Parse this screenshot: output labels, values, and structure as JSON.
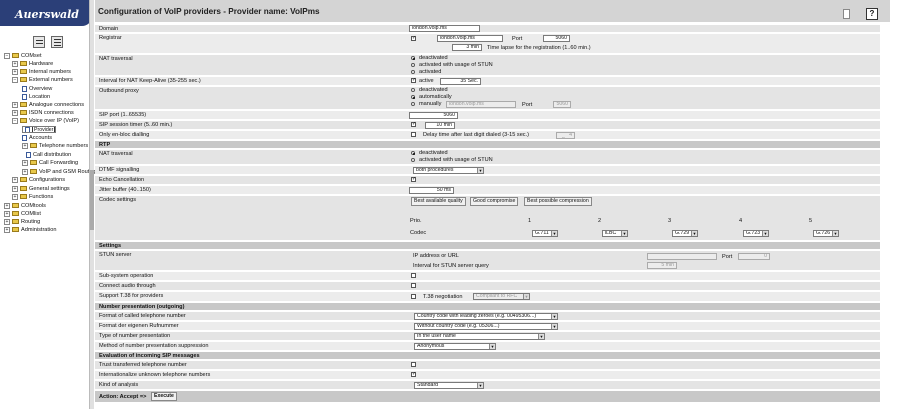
{
  "logo_text": "Auerswald",
  "title": "Configuration of VoIP providers - Provider name: VoIPms",
  "help_label": "?",
  "tree": [
    {
      "label": "COMset",
      "kind": "folder"
    },
    {
      "label": "Hardware",
      "kind": "folder"
    },
    {
      "label": "Internal numbers",
      "kind": "folder"
    },
    {
      "label": "External numbers",
      "kind": "folder"
    },
    {
      "label": "Overview",
      "kind": "page"
    },
    {
      "label": "Location",
      "kind": "page"
    },
    {
      "label": "Analogue connections",
      "kind": "folder"
    },
    {
      "label": "ISDN connections",
      "kind": "folder"
    },
    {
      "label": "Voice over IP (VoIP)",
      "kind": "folder"
    },
    {
      "label": "Provider",
      "kind": "page"
    },
    {
      "label": "Accounts",
      "kind": "page"
    },
    {
      "label": "Telephone numbers",
      "kind": "folder"
    },
    {
      "label": "Call distribution",
      "kind": "page"
    },
    {
      "label": "Call Forwarding",
      "kind": "folder"
    },
    {
      "label": "VoIP and GSM Routing",
      "kind": "folder"
    },
    {
      "label": "Configurations",
      "kind": "folder"
    },
    {
      "label": "General settings",
      "kind": "folder"
    },
    {
      "label": "Functions",
      "kind": "folder"
    },
    {
      "label": "COMtools",
      "kind": "folder"
    },
    {
      "label": "COMlist",
      "kind": "folder"
    },
    {
      "label": "Routing",
      "kind": "folder"
    },
    {
      "label": "Administration",
      "kind": "folder"
    }
  ],
  "form": {
    "domain": {
      "label": "Domain",
      "value": "london.voip.ms"
    },
    "registrar": {
      "label": "Registrar",
      "host": "london.voip.ms",
      "port_label": "Port",
      "port": "5060",
      "time": "3 min",
      "time_label": "Time lapse for the registration (1..60 min.)"
    },
    "nat": {
      "label": "NAT traversal",
      "options": [
        "deactivated",
        "activated with usage of STUN",
        "activated"
      ]
    },
    "keepalive": {
      "label": "Interval for NAT Keep-Alive (35-255 sec.)",
      "cb_label": "active",
      "value": "35 Sec."
    },
    "outbound": {
      "label": "Outbound proxy",
      "options": [
        "deactivated",
        "automatically",
        "manually"
      ],
      "host": "london.voip.ms",
      "port_label": "Port",
      "port": "5060"
    },
    "sip_port": {
      "label": "SIP port (1..65535)",
      "value": "5060"
    },
    "session_timer": {
      "label": "SIP session timer (5..60 min.)",
      "value": "10 min"
    },
    "enbloc": {
      "label": "Only en-bloc dialling",
      "cb_label": "Delay time after last digit dialed (3-15 sec.)",
      "value": "4 Sec."
    }
  },
  "rtp": {
    "section": "RTP",
    "nat": {
      "label": "NAT traversal",
      "options": [
        "deactivated",
        "activated with usage of STUN"
      ]
    },
    "dtmf": {
      "label": "DTMF signalling",
      "value": "both procedures"
    },
    "echo": {
      "label": "Echo Cancellation"
    },
    "jitter": {
      "label": "Jitter buffer (40..150)",
      "value": "50 ms"
    },
    "codec": {
      "label": "Codec settings",
      "buttons": [
        "Best available quality",
        "Good compromise",
        "Best possible compression"
      ],
      "prio_label": "Prio.",
      "codec_label": "Codec",
      "prios": [
        "1",
        "2",
        "3",
        "4",
        "5"
      ],
      "codecs": [
        "G.711",
        "iLBC",
        "G.729",
        "G.723",
        "G.726"
      ]
    }
  },
  "settings": {
    "section": "Settings",
    "stun": {
      "label": "STUN server",
      "addr_label": "IP address or URL",
      "port_label": "Port",
      "port": "0",
      "interval_label": "Interval for STUN server query",
      "interval": "5 min"
    },
    "subsystem": {
      "label": "Sub-system operation"
    },
    "connect_audio": {
      "label": "Connect audio through"
    },
    "t38": {
      "label": "Support T.38 for providers",
      "cb_label": "T.38 negotiation",
      "value": "Compliant to RFC"
    }
  },
  "numpres": {
    "section": "Number presentation (outgoing)",
    "called": {
      "label": "Format of called telephone number",
      "value": "Country code with leading zeroes (e.g. 00495306...)"
    },
    "own": {
      "label": "Format der eigenen Rufnummer",
      "value": "Without country code (e.g. 05306...)"
    },
    "type": {
      "label": "Type of number presentation",
      "value": "In the user name"
    },
    "method": {
      "label": "Method of number presentation suppression",
      "value": "Anonymous"
    }
  },
  "incoming": {
    "section": "Evaluation of incoming SIP messages",
    "trust": {
      "label": "Trust transferred telephone number"
    },
    "intl": {
      "label": "Internationalize unknown telephone numbers"
    },
    "kind": {
      "label": "Kind of analysis",
      "value": "Standard"
    }
  },
  "action": {
    "label": "Action: Accept =>",
    "execute": "Execute"
  }
}
